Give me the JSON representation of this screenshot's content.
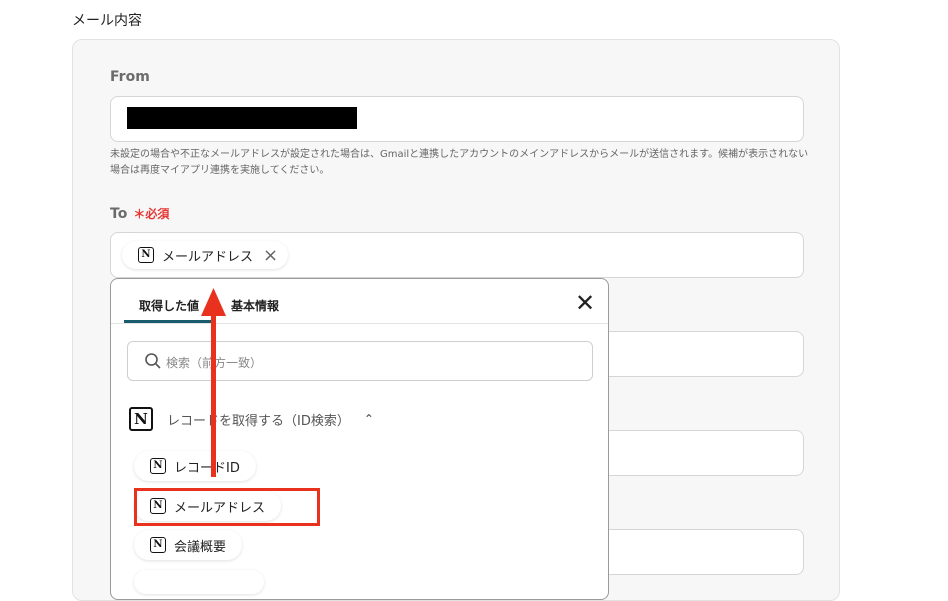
{
  "section_title": "メール内容",
  "from": {
    "label": "From",
    "help": "未設定の場合や不正なメールアドレスが設定された場合は、Gmailと連携したアカウントのメインアドレスからメールが送信されます。候補が表示されない場合は再度マイアプリ連携を実施してください。"
  },
  "to": {
    "label": "To",
    "required": "＊必須",
    "chip_label": "メールアドレス"
  },
  "dropdown": {
    "tabs": [
      "取得した値",
      "基本情報"
    ],
    "search_placeholder": "検索（前方一致）",
    "group_label": "レコードを取得する（ID検索）",
    "items": [
      "レコードID",
      "メールアドレス",
      "会議概要"
    ]
  },
  "colors": {
    "highlight": "#e8321e",
    "tab_underline": "#1a5c6b",
    "required": "#e53935"
  }
}
